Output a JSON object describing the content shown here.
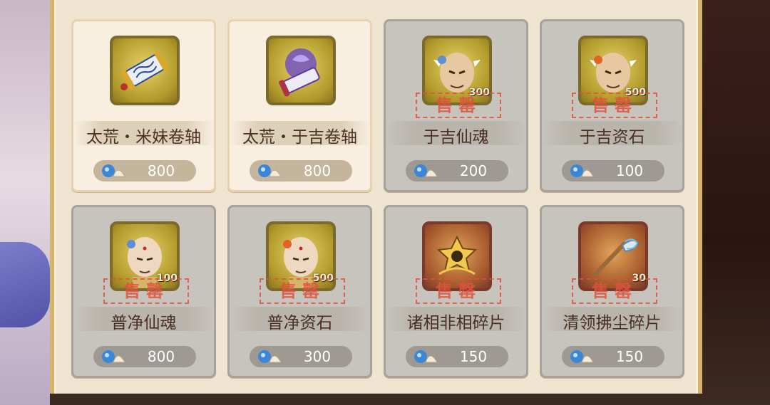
{
  "shop": {
    "items": [
      {
        "name": "太荒・米妹卷轴",
        "price": "800",
        "sold_out": false,
        "icon": "scroll-blue-icon",
        "qty": ""
      },
      {
        "name": "太荒・于吉卷轴",
        "price": "800",
        "sold_out": false,
        "icon": "scroll-purple-icon",
        "qty": ""
      },
      {
        "name": "于吉仙魂",
        "price": "200",
        "sold_out": true,
        "icon": "yuji-portrait-icon",
        "qty": "300"
      },
      {
        "name": "于吉资石",
        "price": "100",
        "sold_out": true,
        "icon": "yuji-portrait-orange-icon",
        "qty": "500"
      },
      {
        "name": "普净仙魂",
        "price": "800",
        "sold_out": true,
        "icon": "monk-portrait-icon",
        "qty": "100"
      },
      {
        "name": "普净资石",
        "price": "300",
        "sold_out": true,
        "icon": "monk-portrait-orange-icon",
        "qty": "500"
      },
      {
        "name": "诸相非相碎片",
        "price": "150",
        "sold_out": true,
        "icon": "golden-artifact-icon",
        "qty": ""
      },
      {
        "name": "清领拂尘碎片",
        "price": "150",
        "sold_out": true,
        "icon": "whisk-artifact-icon",
        "qty": "30"
      }
    ],
    "sold_out_label": "售罄",
    "currency_icon": "shell-currency-icon",
    "colors": {
      "accent": "#d7b46c",
      "stamp": "#e0533e",
      "card": "#f9efe0",
      "card_sold_out": "#c7c3bd"
    }
  }
}
